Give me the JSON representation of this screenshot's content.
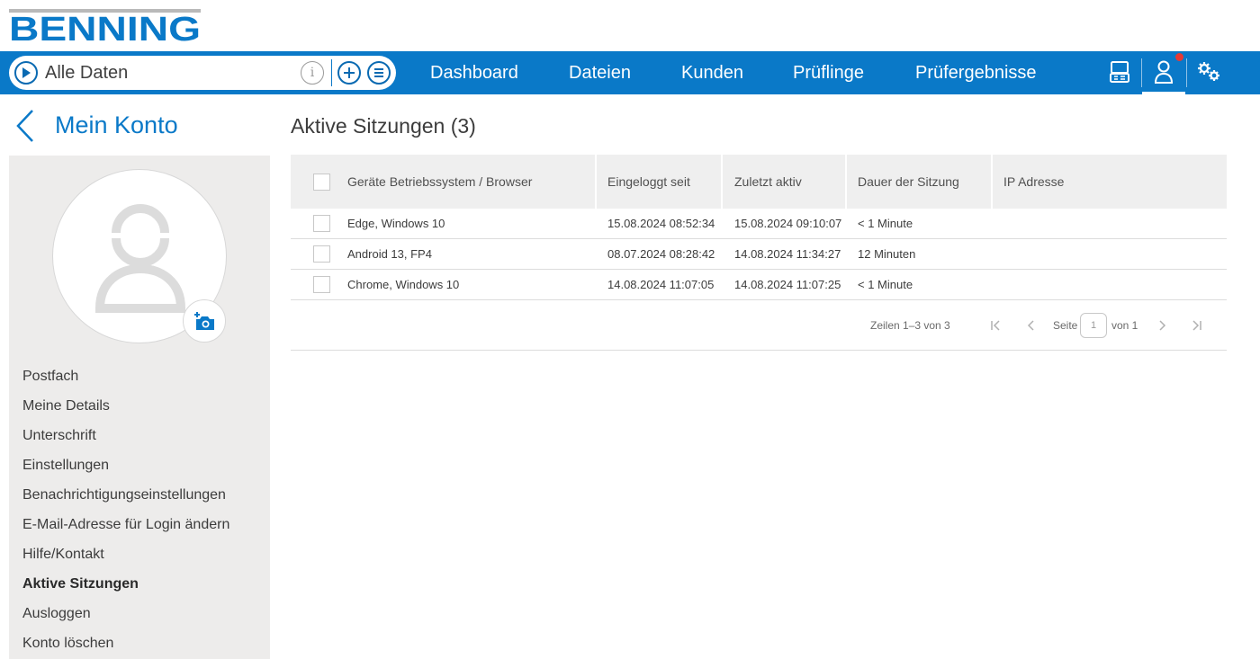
{
  "brand": {
    "logo_text": "BENNING",
    "color": "#0a79c8"
  },
  "search": {
    "label": "Alle Daten"
  },
  "nav": {
    "items": [
      {
        "label": "Dashboard"
      },
      {
        "label": "Dateien"
      },
      {
        "label": "Kunden"
      },
      {
        "label": "Prüflinge"
      },
      {
        "label": "Prüfergebnisse"
      }
    ],
    "icons": [
      "device-icon",
      "user-icon",
      "settings-icon"
    ],
    "user_has_notification": true
  },
  "page": {
    "title": "Mein Konto"
  },
  "sidebar": {
    "items": [
      {
        "label": "Postfach",
        "active": false
      },
      {
        "label": "Meine Details",
        "active": false
      },
      {
        "label": "Unterschrift",
        "active": false
      },
      {
        "label": "Einstellungen",
        "active": false
      },
      {
        "label": "Benachrichtigungseinstellungen",
        "active": false
      },
      {
        "label": "E-Mail-Adresse für Login ändern",
        "active": false
      },
      {
        "label": "Hilfe/Kontakt",
        "active": false
      },
      {
        "label": "Aktive Sitzungen",
        "active": true
      },
      {
        "label": "Ausloggen",
        "active": false
      },
      {
        "label": "Konto löschen",
        "active": false
      }
    ]
  },
  "sessions": {
    "title": "Aktive Sitzungen (3)",
    "columns": [
      "Geräte Betriebssystem / Browser",
      "Eingeloggt seit",
      "Zuletzt aktiv",
      "Dauer der Sitzung",
      "IP Adresse"
    ],
    "rows": [
      [
        "Edge, Windows 10",
        "15.08.2024 08:52:34",
        "15.08.2024 09:10:07",
        "< 1 Minute",
        ""
      ],
      [
        "Android 13, FP4",
        "08.07.2024 08:28:42",
        "14.08.2024 11:34:27",
        "12 Minuten",
        ""
      ],
      [
        "Chrome, Windows 10",
        "14.08.2024 11:07:05",
        "14.08.2024 11:07:25",
        "< 1 Minute",
        ""
      ]
    ],
    "pager": {
      "rows_text": "Zeilen 1–3 von 3",
      "page_label": "Seite",
      "page_value": "1",
      "of_text": "von 1"
    }
  }
}
